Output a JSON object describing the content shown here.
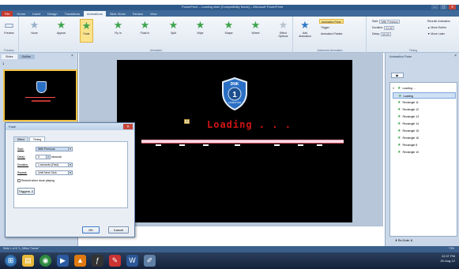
{
  "window": {
    "title": "PowerPoint – Loading slide [Compatibility Mode] – Microsoft PowerPoint"
  },
  "window_controls": {
    "minimize": "–",
    "maximize": "▢",
    "close": "✕"
  },
  "ribbon_tabs": [
    "File",
    "Home",
    "Insert",
    "Design",
    "Transitions",
    "Animations",
    "Slide Show",
    "Review",
    "View"
  ],
  "ribbon": {
    "preview_label": "Preview",
    "effects": [
      "None",
      "Appear",
      "Fade",
      "Fly In",
      "Float In",
      "Split",
      "Wipe",
      "Shape",
      "Wheel",
      "Effect Options"
    ],
    "selected_effect": "Fade",
    "animation_group_label": "Animation",
    "preview_group_label": "Preview",
    "add_animation_label": "Add Animation",
    "animation_pane_button": "Animation Pane",
    "trigger_button": "Trigger",
    "animation_painter_button": "Animation Painter",
    "advanced_group_label": "Advanced Animation",
    "start_label": "Start:",
    "start_value": "With Previous",
    "duration_label": "Duration:",
    "duration_value": "01.00",
    "delay_label": "Delay:",
    "delay_value": "00.00",
    "reorder_label": "Reorder Animation",
    "move_earlier": "▲ Move Earlier",
    "move_later": "▼ Move Later",
    "timing_group_label": "Timing"
  },
  "slides_panel": {
    "tabs": [
      "Slides",
      "Outline"
    ],
    "close": "×",
    "slide_number": "1"
  },
  "slide": {
    "shield_text_top": "DNK",
    "shield_number": "1",
    "shield_text_bottom": "ANIMATION",
    "anim_tag": "0",
    "loading_text": "Loading . . ."
  },
  "notes": {
    "placeholder": "Click to add notes"
  },
  "dialog": {
    "title": "Fade",
    "close": "✕",
    "tabs": [
      "Effect",
      "Timing"
    ],
    "active_tab": "Timing",
    "start_label": "Start:",
    "start_value": "With Previous",
    "delay_label": "Delay:",
    "delay_value": "0",
    "delay_unit": "seconds",
    "duration_label": "Duration:",
    "duration_value": "1 seconds (Fast)",
    "repeat_label": "Repeat:",
    "repeat_value": "Until Next Click",
    "rewind_label": "Rewind when done playing",
    "triggers_button": "Triggers ⇓",
    "ok_button": "OK",
    "cancel_button": "Cancel"
  },
  "anim_pane": {
    "title": "Animation Pane",
    "close": "×",
    "play_button": "▶",
    "items": [
      {
        "num": "0",
        "name": "Loading ...",
        "selected": false
      },
      {
        "num": "",
        "name": "Loading",
        "selected": true
      },
      {
        "num": "",
        "name": "Rectangle 11",
        "selected": false
      },
      {
        "num": "",
        "name": "Rectangle 12",
        "selected": false
      },
      {
        "num": "",
        "name": "Rectangle 13",
        "selected": false
      },
      {
        "num": "",
        "name": "Rectangle 14",
        "selected": false
      },
      {
        "num": "",
        "name": "Rectangle 15",
        "selected": false
      },
      {
        "num": "",
        "name": "Rectangle 16",
        "selected": false
      },
      {
        "num": "",
        "name": "Rectangle 8",
        "selected": false
      },
      {
        "num": "",
        "name": "Rectangle 10",
        "selected": false
      }
    ],
    "reorder_label": "Re-Order"
  },
  "statusbar": {
    "left": "Slide 1 of 6   \"1_Office Theme\"",
    "zoom": "73%"
  },
  "taskbar": {
    "icons": [
      "start-orb",
      "explorer",
      "chrome",
      "media",
      "vlc",
      "flash",
      "paint",
      "word",
      "sketch"
    ],
    "time": "12:37 PM",
    "date": "26-Aug-12"
  },
  "colors": {
    "loading_text": "#d01414",
    "shield": "#2a6fc4",
    "selected": "#fbe38c"
  }
}
